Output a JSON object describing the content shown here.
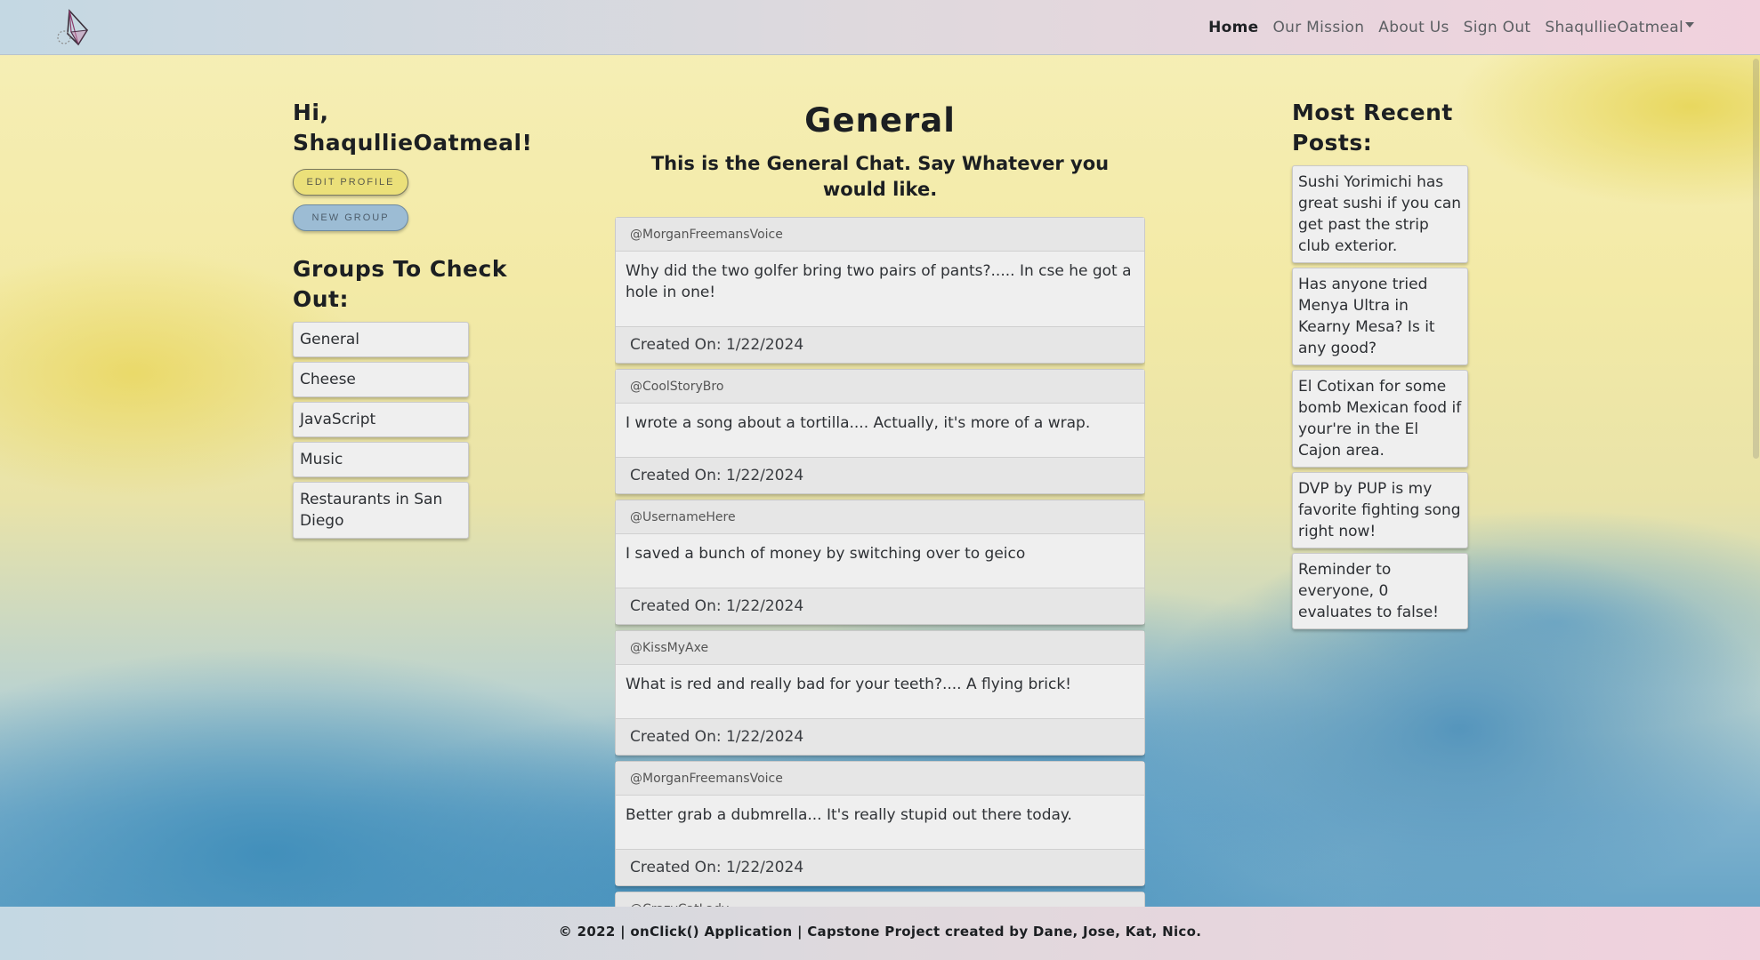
{
  "nav": {
    "links": [
      "Home",
      "Our Mission",
      "About Us",
      "Sign Out"
    ],
    "user_menu": "ShaqullieOatmeal"
  },
  "left": {
    "greeting": "Hi, ShaqullieOatmeal!",
    "edit_profile": "EDIT PROFILE",
    "new_group": "NEW GROUP",
    "groups_heading": "Groups To Check Out:",
    "groups": [
      "General",
      "Cheese",
      "JavaScript",
      "Music",
      "Restaurants in San Diego"
    ]
  },
  "center": {
    "title": "General",
    "subtitle": "This is the General Chat. Say Whatever you would like.",
    "posts": [
      {
        "user": "@MorganFreemansVoice",
        "text": "Why did the two golfer bring two pairs of pants?..... In cse he got a hole in one!",
        "created": "Created On: 1/22/2024"
      },
      {
        "user": "@CoolStoryBro",
        "text": "I wrote a song about a tortilla.... Actually, it's more of a wrap.",
        "created": "Created On: 1/22/2024"
      },
      {
        "user": "@UsernameHere",
        "text": "I saved a bunch of money by switching over to geico",
        "created": "Created On: 1/22/2024"
      },
      {
        "user": "@KissMyAxe",
        "text": "What is red and really bad for your teeth?.... A flying brick!",
        "created": "Created On: 1/22/2024"
      },
      {
        "user": "@MorganFreemansVoice",
        "text": "Better grab a dubmrella... It's really stupid out there today.",
        "created": "Created On: 1/22/2024"
      },
      {
        "user": "@CrazyCatLady",
        "text": "",
        "created": ""
      }
    ]
  },
  "right": {
    "heading": "Most Recent Posts:",
    "items": [
      "Sushi Yorimichi has great sushi if you can get past the strip club exterior.",
      "Has anyone tried Menya Ultra in Kearny Mesa? Is it any good?",
      "El Cotixan for some bomb Mexican food if your're in the El Cajon area.",
      "DVP by PUP is my favorite fighting song right now!",
      "Reminder to everyone, 0 evaluates to false!"
    ]
  },
  "footer": {
    "text": "© 2022 | onClick() Application | Capstone Project created by Dane, Jose, Kat, Nico."
  },
  "colors": {
    "edit_button": "#ebe07a",
    "new_group_button": "#9cbcd4",
    "card": "#efefef"
  }
}
